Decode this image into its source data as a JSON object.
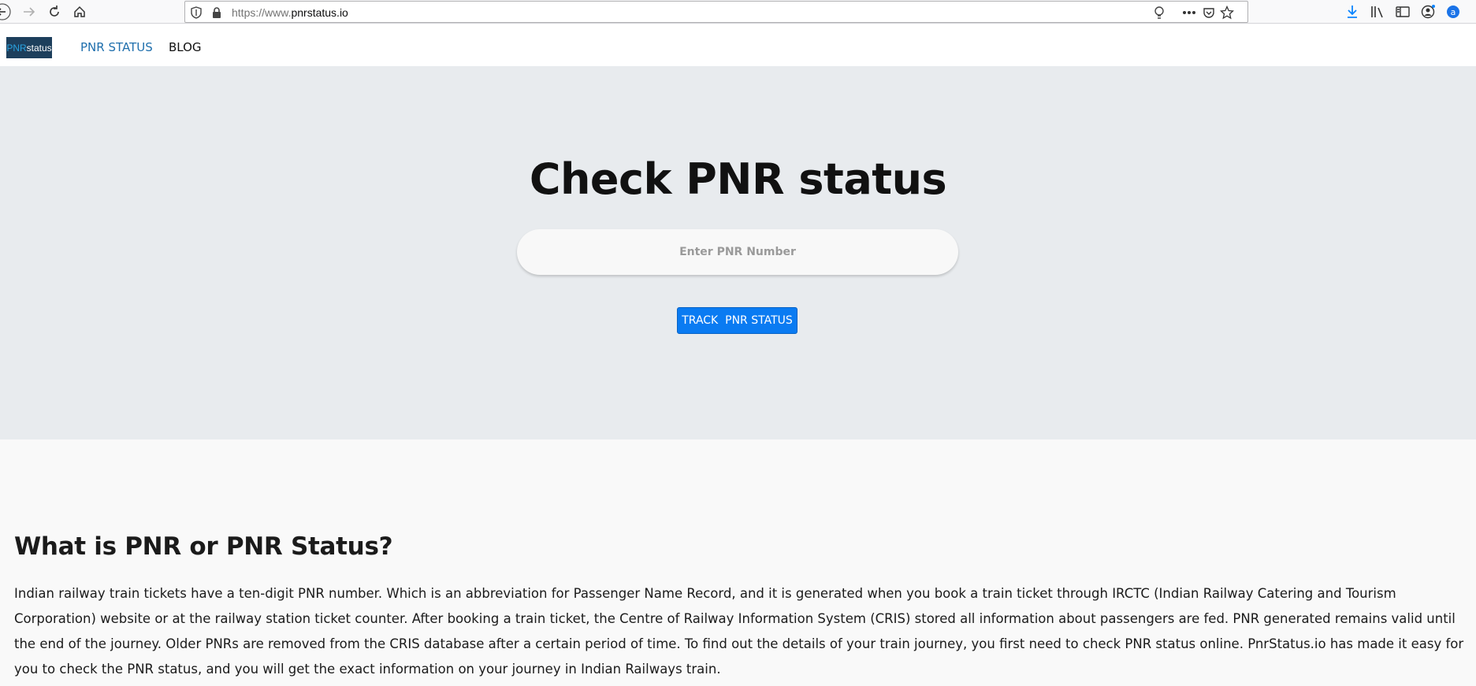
{
  "browser": {
    "url_prefix": "https://www.",
    "url_domain": "pnrstatus.io"
  },
  "nav": {
    "logo_pnr": "PNR",
    "logo_status": "status",
    "link_pnr_status": "PNR STATUS",
    "link_blog": "BLOG"
  },
  "hero": {
    "title": "Check PNR status",
    "input_placeholder": "Enter PNR Number",
    "button_label": "TRACK  PNR STATUS"
  },
  "content": {
    "heading": "What is PNR or PNR Status?",
    "paragraph": "Indian railway train tickets have a ten-digit PNR number. Which is an abbreviation for Passenger Name Record, and it is generated when you book a train ticket through IRCTC (Indian Railway Catering and Tourism Corporation) website or at the railway station ticket counter. After booking a train ticket, the Centre of Railway Information System (CRIS) stored all information about passengers are fed. PNR generated remains valid until the end of the journey. Older PNRs are removed from the CRIS database after a certain period of time. To find out the details of your train journey, you first need to check PNR status online. PnrStatus.io has made it easy for you to check the PNR status, and you will get the exact information on your journey in Indian Railways train."
  },
  "colors": {
    "hero_bg": "#e8ebee",
    "button": "#0a7bf2",
    "active_link": "#1f6fad",
    "logo_bg": "#1d3f5c"
  }
}
